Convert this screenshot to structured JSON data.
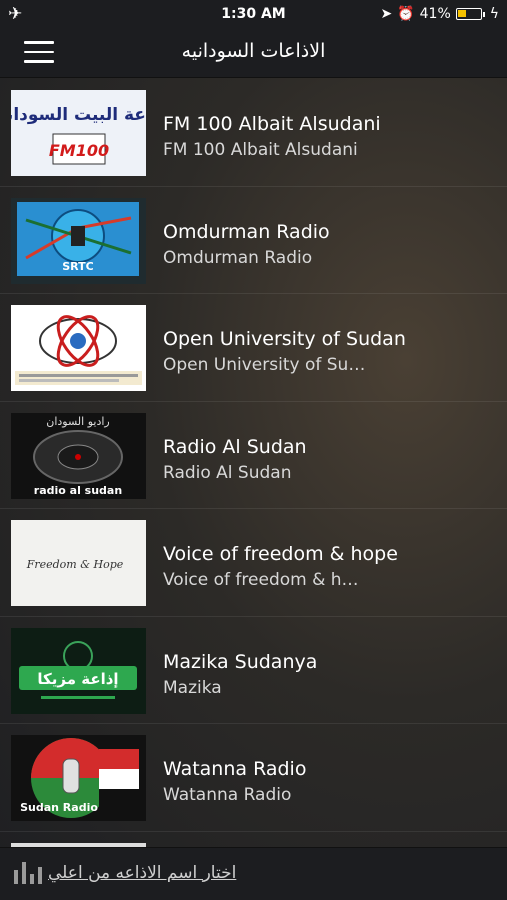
{
  "status": {
    "airplane_icon": "airplane-icon",
    "time": "1:30 AM",
    "battery_text": "41%",
    "battery_level": 0.41,
    "battery_color": "#f5c100"
  },
  "nav": {
    "title": "الاذاعات السودانيه"
  },
  "stations": [
    {
      "title": "FM 100 Albait Alsudani",
      "subtitle": "FM 100 Albait Alsudani",
      "logo_text": "إذاعة البيت السوداني",
      "logo_badge": "FM100"
    },
    {
      "title": "Omdurman Radio",
      "subtitle": "Omdurman Radio",
      "logo_text": "SRTC"
    },
    {
      "title": "Open University of Sudan",
      "subtitle": "Open University of Su…"
    },
    {
      "title": "Radio Al Sudan",
      "subtitle": "Radio Al Sudan",
      "logo_text": "radio al sudan",
      "logo_top": "راديو السودان"
    },
    {
      "title": "Voice of freedom & hope",
      "subtitle": "Voice of freedom & h…",
      "logo_text": "Freedom & Hope"
    },
    {
      "title": "Mazika Sudanya",
      "subtitle": "Mazika",
      "logo_text": "إذاعة مزيكا"
    },
    {
      "title": "Watanna Radio",
      "subtitle": "Watanna Radio",
      "logo_text": "Sudan Radio"
    }
  ],
  "bottom": {
    "label": "اختار اسم الاذاعه من اعلي"
  }
}
